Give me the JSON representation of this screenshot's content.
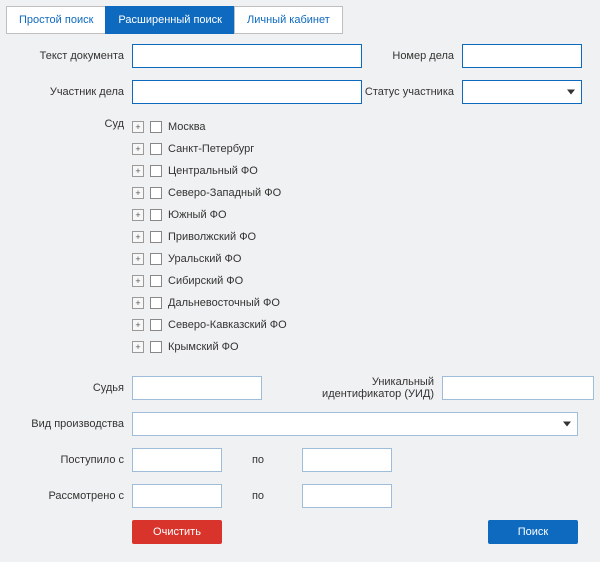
{
  "tabs": {
    "simple": "Простой поиск",
    "advanced": "Расширенный поиск",
    "account": "Личный кабинет"
  },
  "labels": {
    "doc_text": "Текст документа",
    "case_number": "Номер дела",
    "participant": "Участник дела",
    "participant_status": "Статус участника",
    "court": "Суд",
    "judge": "Судья",
    "uid_line1": "Уникальный",
    "uid_line2": "идентификатор (УИД)",
    "proceeding_type": "Вид производства",
    "received_from": "Поступило с",
    "to": "по",
    "considered_from": "Рассмотрено с"
  },
  "court_tree": [
    "Москва",
    "Санкт-Петербург",
    "Центральный ФО",
    "Северо-Западный ФО",
    "Южный ФО",
    "Приволжский ФО",
    "Уральский ФО",
    "Сибирский ФО",
    "Дальневосточный ФО",
    "Северо-Кавказский ФО",
    "Крымский ФО"
  ],
  "buttons": {
    "clear": "Очистить",
    "search": "Поиск"
  }
}
